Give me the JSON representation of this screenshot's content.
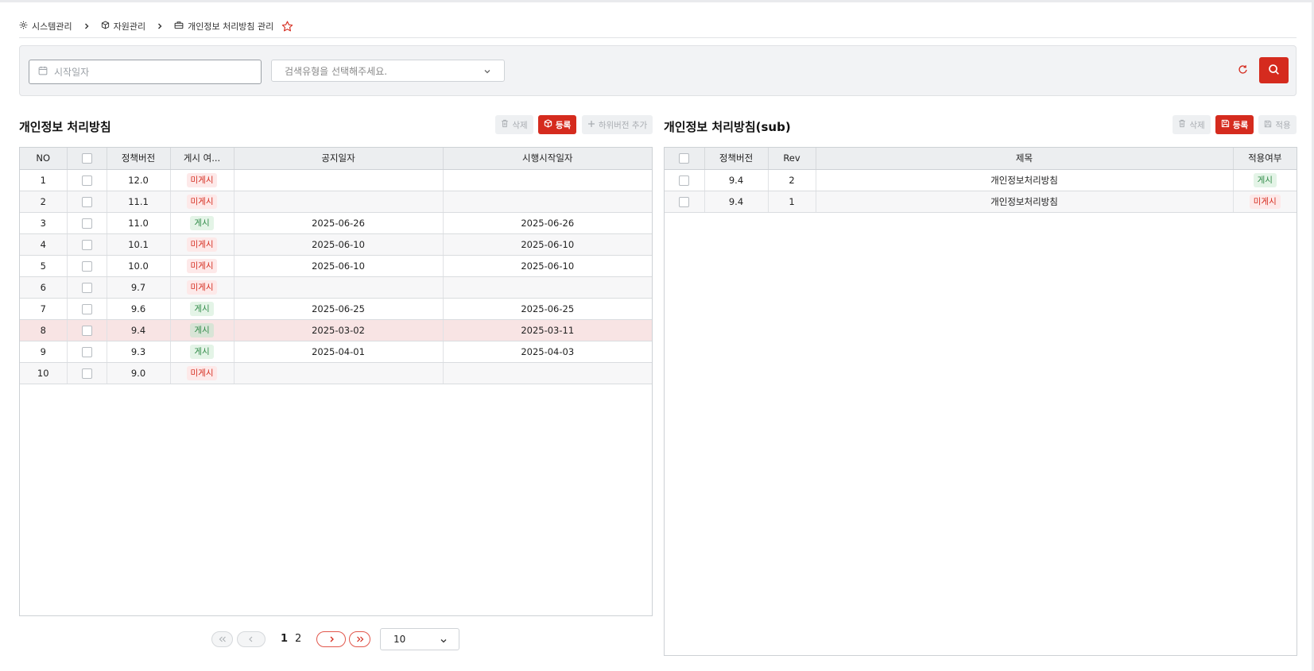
{
  "breadcrumb": {
    "items": [
      "시스템관리",
      "자원관리",
      "개인정보 처리방침 관리"
    ]
  },
  "search": {
    "date_placeholder": "시작일자",
    "type_placeholder": "검색유형을 선택해주세요."
  },
  "left_panel": {
    "title": "개인정보 처리방침",
    "buttons": {
      "delete": "삭제",
      "register": "등록",
      "add_sub_version": "하위버전 추가"
    },
    "columns": [
      "NO",
      "",
      "정책버전",
      "게시 여...",
      "공지일자",
      "시행시작일자"
    ],
    "rows": [
      {
        "no": "1",
        "version": "12.0",
        "status": "미게시",
        "published": false,
        "notice_date": "",
        "start_date": ""
      },
      {
        "no": "2",
        "version": "11.1",
        "status": "미게시",
        "published": false,
        "notice_date": "",
        "start_date": ""
      },
      {
        "no": "3",
        "version": "11.0",
        "status": "게시",
        "published": true,
        "notice_date": "2025-06-26",
        "start_date": "2025-06-26"
      },
      {
        "no": "4",
        "version": "10.1",
        "status": "미게시",
        "published": false,
        "notice_date": "2025-06-10",
        "start_date": "2025-06-10"
      },
      {
        "no": "5",
        "version": "10.0",
        "status": "미게시",
        "published": false,
        "notice_date": "2025-06-10",
        "start_date": "2025-06-10"
      },
      {
        "no": "6",
        "version": "9.7",
        "status": "미게시",
        "published": false,
        "notice_date": "",
        "start_date": ""
      },
      {
        "no": "7",
        "version": "9.6",
        "status": "게시",
        "published": true,
        "notice_date": "2025-06-25",
        "start_date": "2025-06-25"
      },
      {
        "no": "8",
        "version": "9.4",
        "status": "게시",
        "published": true,
        "notice_date": "2025-03-02",
        "start_date": "2025-03-11",
        "selected": true
      },
      {
        "no": "9",
        "version": "9.3",
        "status": "게시",
        "published": true,
        "notice_date": "2025-04-01",
        "start_date": "2025-04-03"
      },
      {
        "no": "10",
        "version": "9.0",
        "status": "미게시",
        "published": false,
        "notice_date": "",
        "start_date": ""
      }
    ]
  },
  "right_panel": {
    "title": "개인정보 처리방침(sub)",
    "buttons": {
      "delete": "삭제",
      "register": "등록",
      "apply": "적용"
    },
    "columns": [
      "",
      "정책버전",
      "Rev",
      "제목",
      "적용여부"
    ],
    "rows": [
      {
        "version": "9.4",
        "rev": "2",
        "title": "개인정보처리방침",
        "status": "게시",
        "published": true
      },
      {
        "version": "9.4",
        "rev": "1",
        "title": "개인정보처리방침",
        "status": "미게시",
        "published": false
      }
    ]
  },
  "pagination": {
    "pages": [
      "1",
      "2"
    ],
    "current_page": "1",
    "page_size": "10"
  },
  "colors": {
    "accent": "#d52b1e",
    "published": "#2f8a47",
    "unpublished": "#d52b1e",
    "selected_row": "#f8e4e4"
  }
}
